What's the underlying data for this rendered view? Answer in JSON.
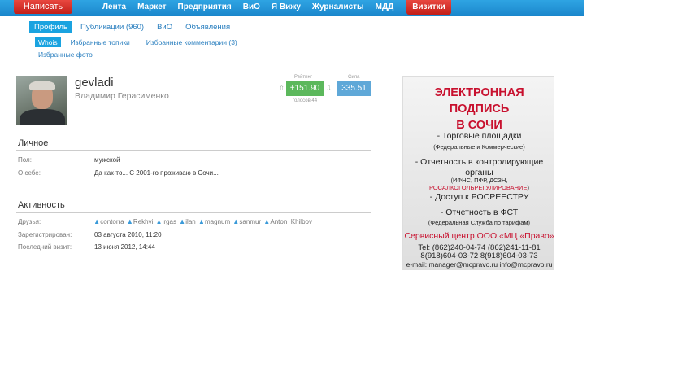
{
  "topbar": {
    "write_label": "Написать",
    "nav": [
      "Лента",
      "Маркет",
      "Предприятия",
      "ВиО",
      "Я Вижу",
      "Журналисты",
      "МДД"
    ],
    "vizitki_label": "Визитки"
  },
  "tabs": {
    "profile": "Профиль",
    "publications": "Публикации (960)",
    "vio": "ВиО",
    "ads": "Объявления"
  },
  "subtabs": {
    "whois": "Whois",
    "fav_topics": "Избранные топики",
    "fav_comments": "Избранные комментарии (3)",
    "fav_photos": "Избранные фото"
  },
  "profile": {
    "username": "gevladi",
    "fullname": "Владимир Герасименко",
    "rating_label": "Рейтинг",
    "strength_label": "Сила",
    "rating": "+151.90",
    "strength": "335.51",
    "votes": "голосов:44",
    "vote_up": "⇧",
    "vote_down": "⇩"
  },
  "personal": {
    "title": "Личное",
    "gender_label": "Пол:",
    "gender_value": "мужской",
    "about_label": "О себе:",
    "about_value": "Да как-то... С 2001-го проживаю в Сочи..."
  },
  "activity": {
    "title": "Активность",
    "friends_label": "Друзья:",
    "friends": [
      "contorra",
      "Rekhvi",
      "lrgas",
      "ilan",
      "magnum",
      "sanmur",
      "Anton_Khilbov"
    ],
    "registered_label": "Зарегистрирован:",
    "registered_value": "03 августа 2010, 11:20",
    "last_visit_label": "Последний визит:",
    "last_visit_value": "13 июня 2012, 14:44"
  },
  "ad": {
    "title_line1": "ЭЛЕКТРОННАЯ ПОДПИСЬ",
    "title_line2": "В СОЧИ",
    "item1": "- Торговые площадки",
    "item1_sub": "(Федеральные и Коммерческие)",
    "item2a": "- Отчетность в контролирующие",
    "item2b": "органы",
    "item2_sub_black": "(ИФНС, ПФР, ДСЗН,",
    "item2_sub_red": "РОСАЛКОГОЛЬРЕГУЛИРОВАНИЕ",
    "item2_sub_end": ")",
    "item3": "- Доступ к РОСРЕЕСТРУ",
    "item4": "- Отчетность в ФСТ",
    "item4_sub": "(Федеральная Служба по тарифам)",
    "center": "Сервисный центр ООО «МЦ «Право»",
    "phone1": "Tel: (862)240-04-74  (862)241-11-81",
    "phone2": "8(918)604-03-72  8(918)604-03-73",
    "email": "e-mail: manager@mcpravo.ru info@mcpravo.ru"
  },
  "colors": {
    "topbar": "#1a86cb",
    "accent_red": "#c21f19",
    "tab_active": "#1aa3e0",
    "rating_green": "#5cb85c",
    "strength_blue": "#5fa8d8"
  }
}
